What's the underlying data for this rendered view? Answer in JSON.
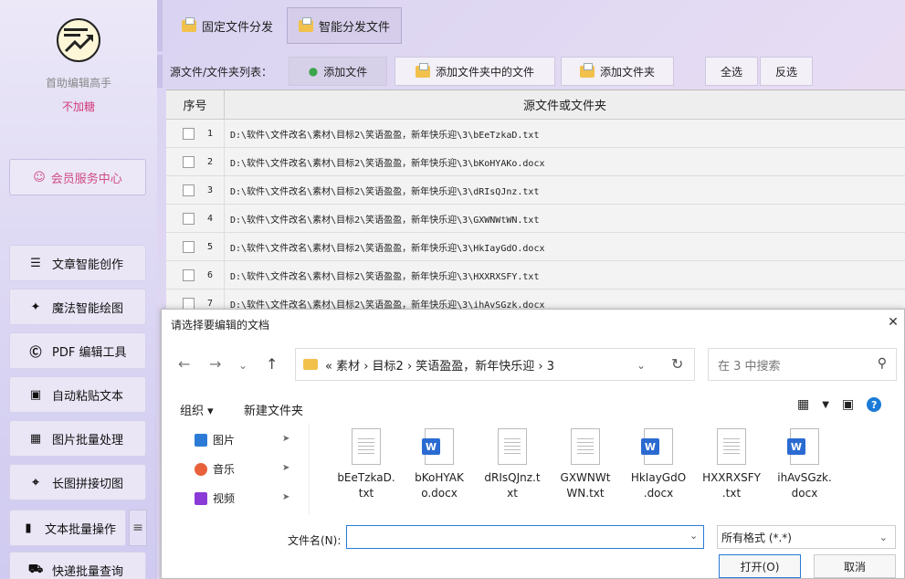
{
  "sidebar": {
    "app_name": "首助编辑高手",
    "app_sub": "不加糖",
    "member_label": "会员服务中心",
    "items": [
      {
        "label": "文章智能创作",
        "icon": "menu-lines-icon"
      },
      {
        "label": "魔法智能绘图",
        "icon": "brush-icon"
      },
      {
        "label": "PDF 编辑工具",
        "icon": "pdf-icon"
      },
      {
        "label": "自动粘贴文本",
        "icon": "clipboard-icon"
      },
      {
        "label": "图片批量处理",
        "icon": "image-icon"
      },
      {
        "label": "长图拼接切图",
        "icon": "crop-icon"
      },
      {
        "label": "文本批量操作",
        "icon": "text-icon"
      },
      {
        "label": "快递批量查询",
        "icon": "truck-icon"
      }
    ]
  },
  "top_tabs": [
    {
      "label": "固定文件分发"
    },
    {
      "label": "智能分发文件"
    }
  ],
  "source": {
    "label": "源文件/文件夹列表：",
    "add_file": "添加文件",
    "add_folder_files": "添加文件夹中的文件",
    "add_folder": "添加文件夹",
    "select_all": "全选",
    "invert": "反选"
  },
  "table": {
    "col_index": "序号",
    "col_path": "源文件或文件夹",
    "rows": [
      {
        "index": "1",
        "path": "D:\\软件\\文件改名\\素材\\目标2\\笑语盈盈，新年快乐迎\\3\\bEeTzkaD.txt"
      },
      {
        "index": "2",
        "path": "D:\\软件\\文件改名\\素材\\目标2\\笑语盈盈，新年快乐迎\\3\\bKoHYAKo.docx"
      },
      {
        "index": "3",
        "path": "D:\\软件\\文件改名\\素材\\目标2\\笑语盈盈，新年快乐迎\\3\\dRIsQJnz.txt"
      },
      {
        "index": "4",
        "path": "D:\\软件\\文件改名\\素材\\目标2\\笑语盈盈，新年快乐迎\\3\\GXWNWtWN.txt"
      },
      {
        "index": "5",
        "path": "D:\\软件\\文件改名\\素材\\目标2\\笑语盈盈，新年快乐迎\\3\\HkIayGdO.docx"
      },
      {
        "index": "6",
        "path": "D:\\软件\\文件改名\\素材\\目标2\\笑语盈盈，新年快乐迎\\3\\HXXRXSFY.txt"
      },
      {
        "index": "7",
        "path": "D:\\软件\\文件改名\\素材\\目标2\\笑语盈盈，新年快乐迎\\3\\ihAvSGzk.docx"
      }
    ]
  },
  "dialog": {
    "title": "请选择要编辑的文档",
    "close": "✕",
    "address": "«  素材  ›  目标2  ›  笑语盈盈，新年快乐迎  ›  3",
    "search_placeholder": "在 3 中搜索",
    "organize": "组织 ▾",
    "new_folder": "新建文件夹",
    "nav": [
      {
        "label": "图片",
        "color": "#2b7bd6"
      },
      {
        "label": "音乐",
        "color": "#e8613a"
      },
      {
        "label": "视频",
        "color": "#8a3ad6"
      }
    ],
    "files": [
      {
        "name": "bEeTzkaD.\ntxt",
        "type": "txt"
      },
      {
        "name": "bKoHYAK\no.docx",
        "type": "docx"
      },
      {
        "name": "dRIsQJnz.t\nxt",
        "type": "txt"
      },
      {
        "name": "GXWNWt\nWN.txt",
        "type": "txt"
      },
      {
        "name": "HkIayGdO\n.docx",
        "type": "docx"
      },
      {
        "name": "HXXRXSFY\n.txt",
        "type": "txt"
      },
      {
        "name": "ihAvSGzk.\ndocx",
        "type": "docx"
      }
    ],
    "filename_label": "文件名(N):",
    "filename_value": "",
    "filetype": "所有格式 (*.*)",
    "ok": "打开(O)",
    "cancel": "取消"
  }
}
